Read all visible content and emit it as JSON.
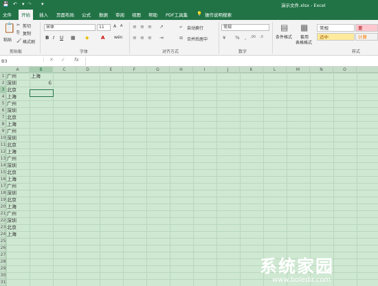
{
  "window": {
    "title": "演示文件.xlsx  -  Excel"
  },
  "tabs": [
    {
      "label": "文件"
    },
    {
      "label": "开始"
    },
    {
      "label": "插入"
    },
    {
      "label": "页面布局"
    },
    {
      "label": "公式"
    },
    {
      "label": "数据"
    },
    {
      "label": "审阅"
    },
    {
      "label": "视图"
    },
    {
      "label": "帮助"
    },
    {
      "label": "PDF工具集"
    }
  ],
  "tell_me": "操作说明搜索",
  "ribbon": {
    "paste": "粘贴",
    "cut": "剪切",
    "copy": "复制",
    "format_painter": "格式刷",
    "font_name": "宋体",
    "font_size": "11",
    "wrap_text": "自动换行",
    "merge_center": "合并后居中",
    "number_format": "常规",
    "conditional_format": "条件格式",
    "table_format": "套用\n表格格式",
    "groups": {
      "clipboard": "剪贴板",
      "font": "字体",
      "alignment": "对齐方式",
      "number": "数字",
      "styles": "样式"
    },
    "styles": [
      {
        "label": "常规",
        "bg": "#ffffff",
        "fg": "#333333"
      },
      {
        "label": "差",
        "bg": "#ffc7ce",
        "fg": "#9c0006"
      },
      {
        "label": "适中",
        "bg": "#ffeb9c",
        "fg": "#9c5700"
      },
      {
        "label": "计算",
        "bg": "#f2f2f2",
        "fg": "#fa7d00"
      }
    ]
  },
  "formula_bar": {
    "name_box": "B3",
    "cancel": "✕",
    "enter": "✓",
    "fx": "fx",
    "formula": ""
  },
  "columns": [
    "A",
    "B",
    "C",
    "D",
    "E",
    "F",
    "G",
    "H",
    "I",
    "J",
    "K",
    "L",
    "M",
    "N",
    "O"
  ],
  "selected_column": "B",
  "rows": [
    "1",
    "2",
    "3",
    "4",
    "5",
    "6",
    "7",
    "8",
    "9",
    "10",
    "11",
    "12",
    "13",
    "14",
    "15",
    "16",
    "17",
    "18",
    "19",
    "20",
    "21",
    "22",
    "23",
    "24",
    "25",
    "26",
    "27",
    "28",
    "29",
    "30",
    "31"
  ],
  "selected_row": "3",
  "column_a": [
    "广州",
    "深圳",
    "北京",
    "上海",
    "广州",
    "深圳",
    "北京",
    "上海",
    "广州",
    "深圳",
    "北京",
    "上海",
    "广州",
    "深圳",
    "北京",
    "上海",
    "广州",
    "深圳",
    "北京",
    "上海",
    "广州",
    "深圳",
    "北京",
    "上海"
  ],
  "b1": "上海",
  "b2": "6",
  "watermark": {
    "text": "系统家园",
    "url": "www.boledir.com"
  },
  "colors": {
    "accent": "#217346",
    "grid_bg": "#cfe8d2"
  }
}
